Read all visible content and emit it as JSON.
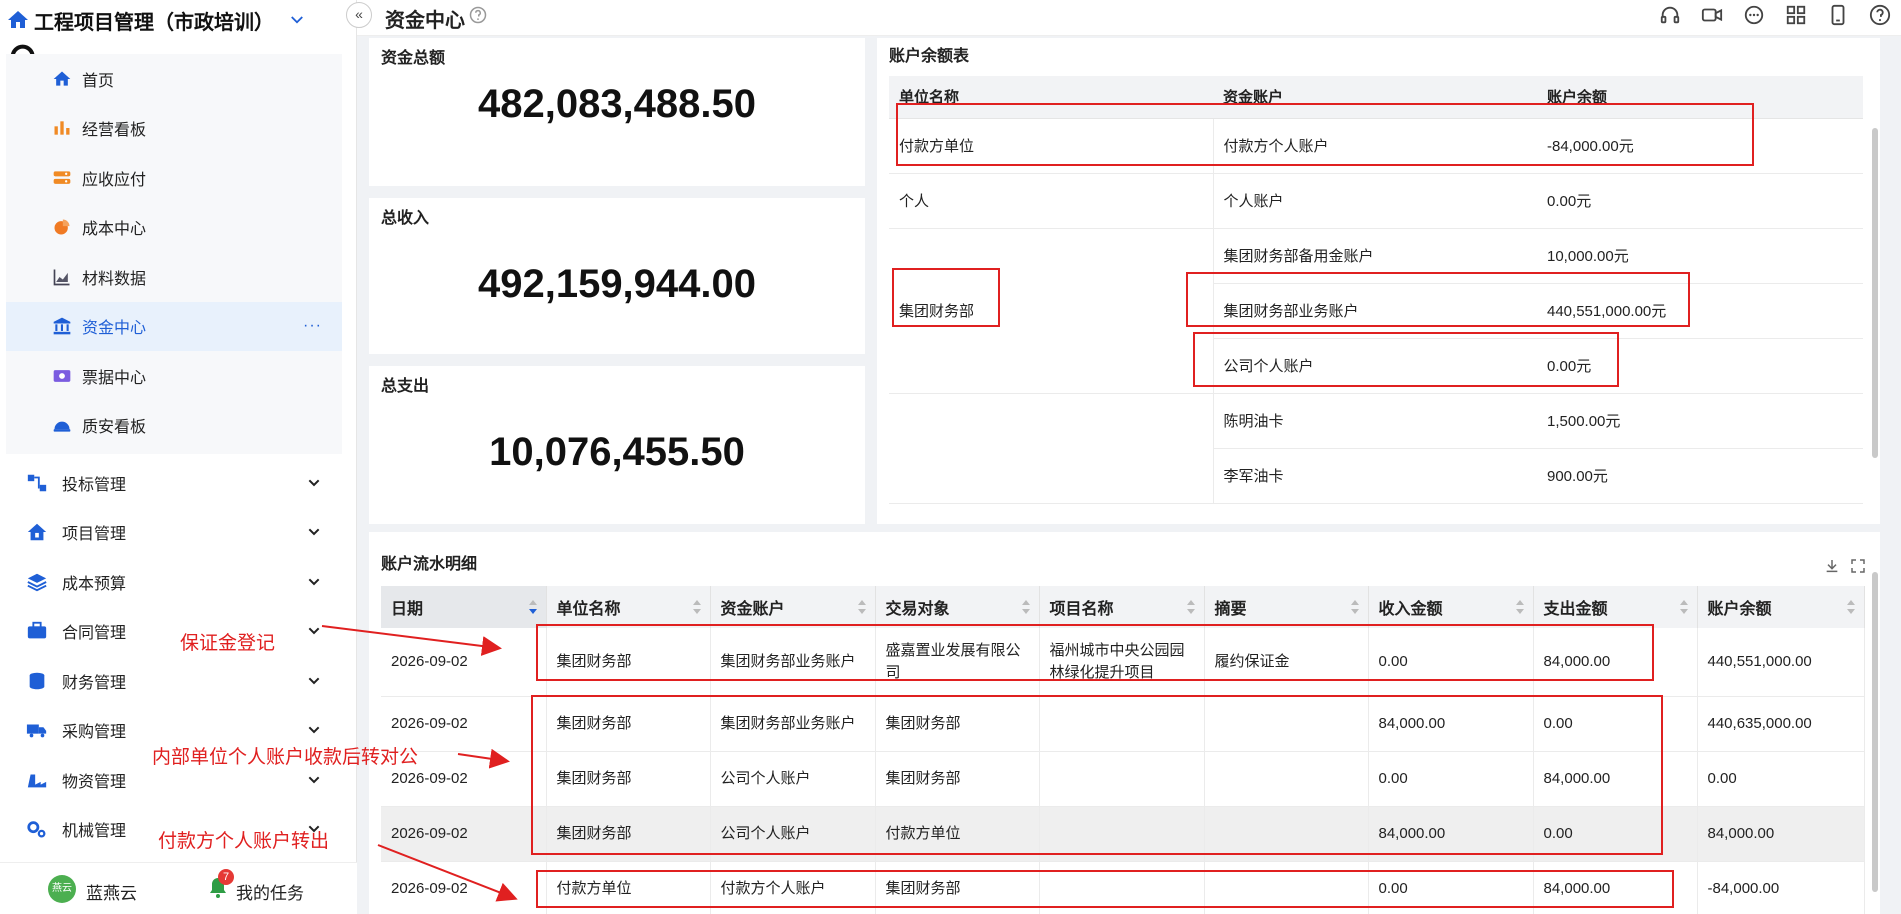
{
  "app": {
    "title": "工程项目管理（市政培训）",
    "page_title": "资金中心"
  },
  "sidebar": {
    "sub_items": [
      {
        "label": "首页",
        "icon": "home-icon"
      },
      {
        "label": "经营看板",
        "icon": "bar-chart-icon"
      },
      {
        "label": "应收应付",
        "icon": "ledger-icon"
      },
      {
        "label": "成本中心",
        "icon": "pie-chart-icon"
      },
      {
        "label": "材料数据",
        "icon": "area-chart-icon"
      },
      {
        "label": "资金中心",
        "icon": "bank-icon",
        "active": true,
        "more": "···"
      },
      {
        "label": "票据中心",
        "icon": "ticket-icon"
      },
      {
        "label": "质安看板",
        "icon": "helmet-icon"
      }
    ],
    "groups": [
      {
        "label": "投标管理",
        "icon": "flow-icon"
      },
      {
        "label": "项目管理",
        "icon": "house-icon"
      },
      {
        "label": "成本预算",
        "icon": "budget-icon"
      },
      {
        "label": "合同管理",
        "icon": "briefcase-icon"
      },
      {
        "label": "财务管理",
        "icon": "coins-icon"
      },
      {
        "label": "采购管理",
        "icon": "truck-icon"
      },
      {
        "label": "物资管理",
        "icon": "material-icon"
      },
      {
        "label": "机械管理",
        "icon": "gears-icon"
      }
    ],
    "footer": {
      "avatar_text": "燕云",
      "user_name": "蓝燕云",
      "task_badge": "7",
      "task_label": "我的任务"
    }
  },
  "stats": {
    "total_funds_label": "资金总额",
    "total_funds_value": "482,083,488.50",
    "total_income_label": "总收入",
    "total_income_value": "492,159,944.00",
    "total_expense_label": "总支出",
    "total_expense_value": "10,076,455.50"
  },
  "balance": {
    "title": "账户余额表",
    "headers": [
      "单位名称",
      "资金账户",
      "账户余额"
    ],
    "rows": [
      {
        "unit": "付款方单位",
        "account": "付款方个人账户",
        "balance": "-84,000.00元"
      },
      {
        "unit": "个人",
        "account": "个人账户",
        "balance": "0.00元"
      },
      {
        "unit": "集团财务部",
        "account": "集团财务部备用金账户",
        "balance": "10,000.00元"
      },
      {
        "unit": "",
        "account": "集团财务部业务账户",
        "balance": "440,551,000.00元"
      },
      {
        "unit": "",
        "account": "公司个人账户",
        "balance": "0.00元"
      },
      {
        "unit": "",
        "account": "陈明油卡",
        "balance": "1,500.00元"
      },
      {
        "unit": "",
        "account": "李军油卡",
        "balance": "900.00元"
      }
    ]
  },
  "flow": {
    "title": "账户流水明细",
    "headers": [
      "日期",
      "单位名称",
      "资金账户",
      "交易对象",
      "项目名称",
      "摘要",
      "收入金额",
      "支出金额",
      "账户余额"
    ],
    "rows": [
      {
        "date": "2026-09-02",
        "unit": "集团财务部",
        "account": "集团财务部业务账户",
        "party": "盛嘉置业发展有限公司",
        "project": "福州城市中央公园园林绿化提升项目",
        "summary": "履约保证金",
        "income": "0.00",
        "expense": "84,000.00",
        "balance": "440,551,000.00"
      },
      {
        "date": "2026-09-02",
        "unit": "集团财务部",
        "account": "集团财务部业务账户",
        "party": "集团财务部",
        "project": "",
        "summary": "",
        "income": "84,000.00",
        "expense": "0.00",
        "balance": "440,635,000.00"
      },
      {
        "date": "2026-09-02",
        "unit": "集团财务部",
        "account": "公司个人账户",
        "party": "集团财务部",
        "project": "",
        "summary": "",
        "income": "0.00",
        "expense": "84,000.00",
        "balance": "0.00"
      },
      {
        "date": "2026-09-02",
        "unit": "集团财务部",
        "account": "公司个人账户",
        "party": "付款方单位",
        "project": "",
        "summary": "",
        "income": "84,000.00",
        "expense": "0.00",
        "balance": "84,000.00",
        "highlight": true
      },
      {
        "date": "2026-09-02",
        "unit": "付款方单位",
        "account": "付款方个人账户",
        "party": "集团财务部",
        "project": "",
        "summary": "",
        "income": "0.00",
        "expense": "84,000.00",
        "balance": "-84,000.00"
      }
    ]
  },
  "annotations": {
    "deposit": "保证金登记",
    "internal": "内部单位个人账户收款后转对公",
    "payer": "付款方个人账户转出"
  },
  "colors": {
    "accent": "#1f5fd6",
    "annotation_red": "#e02020",
    "active_bg": "#e8f1fc"
  }
}
